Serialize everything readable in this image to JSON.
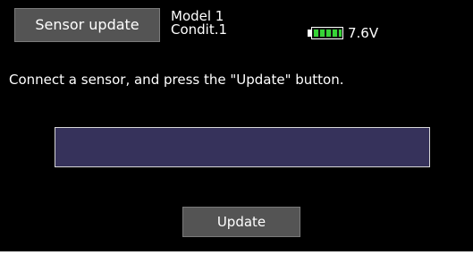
{
  "header": {
    "title_button_label": "Sensor update",
    "model_name": "Model 1",
    "condition_name": "Condit.1",
    "battery": {
      "voltage_text": "7.6V",
      "level_fraction": 1.0,
      "color": "#37d437"
    }
  },
  "main": {
    "instruction_text": "Connect a sensor, and press the \"Update\" button.",
    "sensor_field_value": "",
    "update_button_label": "Update"
  },
  "colors": {
    "screen_background": "#000000",
    "button_background": "#545454",
    "sensor_field_background": "#36325b",
    "sensor_field_border": "#d8d8d8"
  }
}
